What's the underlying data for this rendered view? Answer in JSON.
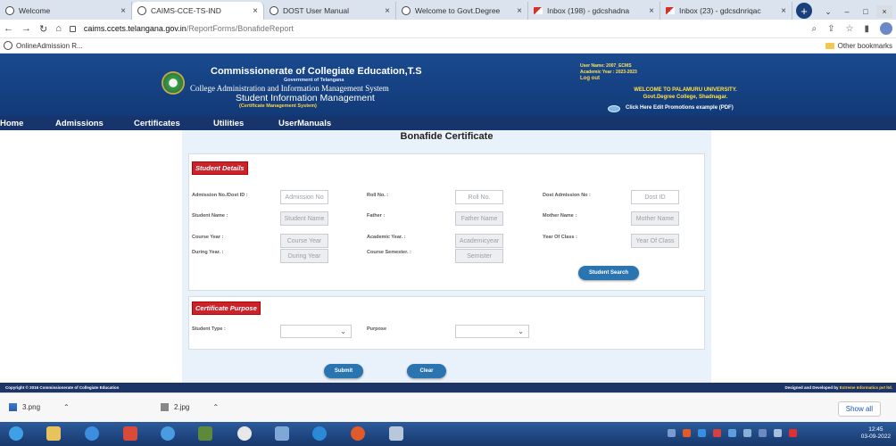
{
  "browser": {
    "tabs": [
      {
        "title": "Welcome",
        "icon": "globe-icon",
        "active": false
      },
      {
        "title": "CAIMS-CCE-TS-IND",
        "icon": "globe-icon",
        "active": true
      },
      {
        "title": "DOST User Manual",
        "icon": "globe-icon",
        "active": false
      },
      {
        "title": "Welcome to Govt.Degree",
        "icon": "globe-icon",
        "active": false
      },
      {
        "title": "Inbox (198) - gdcshadna",
        "icon": "gmail-icon",
        "active": false
      },
      {
        "title": "Inbox (23) - gdcsdnriqac",
        "icon": "gmail-icon",
        "active": false
      }
    ],
    "new_tab": "+",
    "url_domain": "caims.ccets.telangana.gov.in",
    "url_path": "/ReportForms/BonafideReport",
    "bookmark": "OnlineAdmission R...",
    "other_bookmarks": "Other bookmarks"
  },
  "header": {
    "title": "Commissionerate of Collegiate Education,T.S",
    "sub1": "Government of Telangana",
    "sub2": "College Administration and Information Management System",
    "sub3": "Student Information Management",
    "sub4": "(Certificate Management System)",
    "user_line1": "User Name: 2007_ECMS",
    "user_line2": "Academic Year : 2023-2023",
    "logout": "Log out",
    "welcome_line1": "WELCOME TO PALAMURU UNIVERSITY.",
    "welcome_line2": "Govt.Degree College, Shadnagar.",
    "promo_link": "Click Here Edit Promotions example (PDF)"
  },
  "nav": {
    "home": "Home",
    "admissions": "Admissions",
    "certificates": "Certificates",
    "utilities": "Utilities",
    "usermanuals": "UserManuals"
  },
  "page": {
    "title": "Bonafide Certificate",
    "student_details_label": "Student Details",
    "admission_no_label": "Admission No./Dost ID :",
    "admission_no_placeholder": "Admission No",
    "roll_no_label": "Roll No. :",
    "roll_no_placeholder": "Roll No.",
    "dost_label": "Dost Admission No :",
    "dost_placeholder": "Dost ID",
    "student_name_label": "Student Name :",
    "student_name_placeholder": "Student Name",
    "father_label": "Father :",
    "father_placeholder": "Father Name",
    "mother_label": "Mother Name :",
    "mother_placeholder": "Mother Name",
    "course_year_label": "Course Year :",
    "course_year_placeholder": "Course Year",
    "academic_year_label": "Academic Year. :",
    "academic_year_placeholder": "Academicyear",
    "year_of_class_label": "Year Of Class :",
    "year_of_class_placeholder": "Year Of Class",
    "during_year_label": "During Year. :",
    "during_year_placeholder": "During Year",
    "course_semester_label": "Course Semester. :",
    "course_semester_placeholder": "Semister",
    "student_search": "Student Search",
    "certificate_purpose_label": "Certificate Purpose",
    "student_type_label": "Student Type :",
    "purpose_label": "Purpose",
    "submit": "Submit",
    "clear": "Clear"
  },
  "footer": {
    "left": "Copyright © 2016 Commissionerate of Collegiate Education",
    "right_prefix": "Designed and Developed by ",
    "right_company": "Extreme Informatics pvt ltd."
  },
  "downloads": {
    "items": [
      {
        "name": "3.png"
      },
      {
        "name": "2.jpg"
      }
    ],
    "show_all": "Show all"
  },
  "taskbar": {
    "time": "12:45",
    "date": "03-09-2022"
  },
  "colors": {
    "header_blue": "#1a4a8f",
    "nav_blue": "#17356c",
    "section_red": "#c9232b",
    "button_blue": "#2a74b0",
    "panel_bg": "#e9f1fa"
  }
}
